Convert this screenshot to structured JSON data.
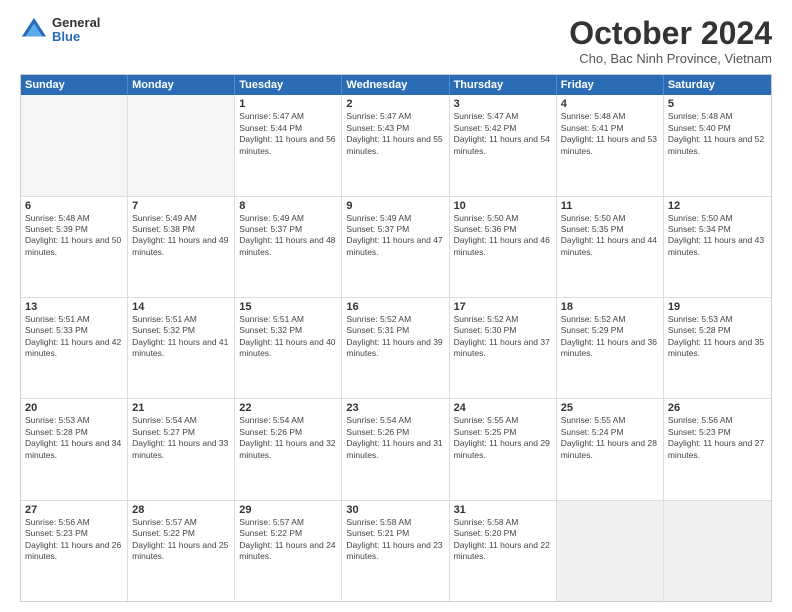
{
  "logo": {
    "general": "General",
    "blue": "Blue"
  },
  "title": "October 2024",
  "subtitle": "Cho, Bac Ninh Province, Vietnam",
  "days": [
    "Sunday",
    "Monday",
    "Tuesday",
    "Wednesday",
    "Thursday",
    "Friday",
    "Saturday"
  ],
  "weeks": [
    [
      {
        "day": "",
        "info": "",
        "empty": true
      },
      {
        "day": "",
        "info": "",
        "empty": true
      },
      {
        "day": "1",
        "info": "Sunrise: 5:47 AM\nSunset: 5:44 PM\nDaylight: 11 hours and 56 minutes."
      },
      {
        "day": "2",
        "info": "Sunrise: 5:47 AM\nSunset: 5:43 PM\nDaylight: 11 hours and 55 minutes."
      },
      {
        "day": "3",
        "info": "Sunrise: 5:47 AM\nSunset: 5:42 PM\nDaylight: 11 hours and 54 minutes."
      },
      {
        "day": "4",
        "info": "Sunrise: 5:48 AM\nSunset: 5:41 PM\nDaylight: 11 hours and 53 minutes."
      },
      {
        "day": "5",
        "info": "Sunrise: 5:48 AM\nSunset: 5:40 PM\nDaylight: 11 hours and 52 minutes."
      }
    ],
    [
      {
        "day": "6",
        "info": "Sunrise: 5:48 AM\nSunset: 5:39 PM\nDaylight: 11 hours and 50 minutes."
      },
      {
        "day": "7",
        "info": "Sunrise: 5:49 AM\nSunset: 5:38 PM\nDaylight: 11 hours and 49 minutes."
      },
      {
        "day": "8",
        "info": "Sunrise: 5:49 AM\nSunset: 5:37 PM\nDaylight: 11 hours and 48 minutes."
      },
      {
        "day": "9",
        "info": "Sunrise: 5:49 AM\nSunset: 5:37 PM\nDaylight: 11 hours and 47 minutes."
      },
      {
        "day": "10",
        "info": "Sunrise: 5:50 AM\nSunset: 5:36 PM\nDaylight: 11 hours and 46 minutes."
      },
      {
        "day": "11",
        "info": "Sunrise: 5:50 AM\nSunset: 5:35 PM\nDaylight: 11 hours and 44 minutes."
      },
      {
        "day": "12",
        "info": "Sunrise: 5:50 AM\nSunset: 5:34 PM\nDaylight: 11 hours and 43 minutes."
      }
    ],
    [
      {
        "day": "13",
        "info": "Sunrise: 5:51 AM\nSunset: 5:33 PM\nDaylight: 11 hours and 42 minutes."
      },
      {
        "day": "14",
        "info": "Sunrise: 5:51 AM\nSunset: 5:32 PM\nDaylight: 11 hours and 41 minutes."
      },
      {
        "day": "15",
        "info": "Sunrise: 5:51 AM\nSunset: 5:32 PM\nDaylight: 11 hours and 40 minutes."
      },
      {
        "day": "16",
        "info": "Sunrise: 5:52 AM\nSunset: 5:31 PM\nDaylight: 11 hours and 39 minutes."
      },
      {
        "day": "17",
        "info": "Sunrise: 5:52 AM\nSunset: 5:30 PM\nDaylight: 11 hours and 37 minutes."
      },
      {
        "day": "18",
        "info": "Sunrise: 5:52 AM\nSunset: 5:29 PM\nDaylight: 11 hours and 36 minutes."
      },
      {
        "day": "19",
        "info": "Sunrise: 5:53 AM\nSunset: 5:28 PM\nDaylight: 11 hours and 35 minutes."
      }
    ],
    [
      {
        "day": "20",
        "info": "Sunrise: 5:53 AM\nSunset: 5:28 PM\nDaylight: 11 hours and 34 minutes."
      },
      {
        "day": "21",
        "info": "Sunrise: 5:54 AM\nSunset: 5:27 PM\nDaylight: 11 hours and 33 minutes."
      },
      {
        "day": "22",
        "info": "Sunrise: 5:54 AM\nSunset: 5:26 PM\nDaylight: 11 hours and 32 minutes."
      },
      {
        "day": "23",
        "info": "Sunrise: 5:54 AM\nSunset: 5:26 PM\nDaylight: 11 hours and 31 minutes."
      },
      {
        "day": "24",
        "info": "Sunrise: 5:55 AM\nSunset: 5:25 PM\nDaylight: 11 hours and 29 minutes."
      },
      {
        "day": "25",
        "info": "Sunrise: 5:55 AM\nSunset: 5:24 PM\nDaylight: 11 hours and 28 minutes."
      },
      {
        "day": "26",
        "info": "Sunrise: 5:56 AM\nSunset: 5:23 PM\nDaylight: 11 hours and 27 minutes."
      }
    ],
    [
      {
        "day": "27",
        "info": "Sunrise: 5:56 AM\nSunset: 5:23 PM\nDaylight: 11 hours and 26 minutes."
      },
      {
        "day": "28",
        "info": "Sunrise: 5:57 AM\nSunset: 5:22 PM\nDaylight: 11 hours and 25 minutes."
      },
      {
        "day": "29",
        "info": "Sunrise: 5:57 AM\nSunset: 5:22 PM\nDaylight: 11 hours and 24 minutes."
      },
      {
        "day": "30",
        "info": "Sunrise: 5:58 AM\nSunset: 5:21 PM\nDaylight: 11 hours and 23 minutes."
      },
      {
        "day": "31",
        "info": "Sunrise: 5:58 AM\nSunset: 5:20 PM\nDaylight: 11 hours and 22 minutes."
      },
      {
        "day": "",
        "info": "",
        "empty": true,
        "shaded": true
      },
      {
        "day": "",
        "info": "",
        "empty": true,
        "shaded": true
      }
    ]
  ]
}
